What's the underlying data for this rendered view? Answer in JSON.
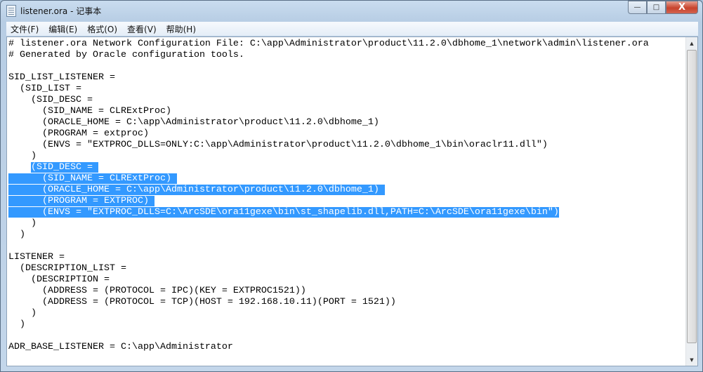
{
  "window": {
    "title": "listener.ora - 记事本",
    "minimize": "—",
    "maximize": "□",
    "close": "X"
  },
  "menu": [
    "文件(F)",
    "编辑(E)",
    "格式(O)",
    "查看(V)",
    "帮助(H)"
  ],
  "editor": {
    "lines": [
      {
        "text": "# listener.ora Network Configuration File: C:\\app\\Administrator\\product\\11.2.0\\dbhome_1\\network\\admin\\listener.ora"
      },
      {
        "text": "# Generated by Oracle configuration tools."
      },
      {
        "text": ""
      },
      {
        "text": "SID_LIST_LISTENER ="
      },
      {
        "text": "  (SID_LIST ="
      },
      {
        "text": "    (SID_DESC ="
      },
      {
        "text": "      (SID_NAME = CLRExtProc)"
      },
      {
        "text": "      (ORACLE_HOME = C:\\app\\Administrator\\product\\11.2.0\\dbhome_1)"
      },
      {
        "text": "      (PROGRAM = extproc)"
      },
      {
        "text": "      (ENVS = \"EXTPROC_DLLS=ONLY:C:\\app\\Administrator\\product\\11.2.0\\dbhome_1\\bin\\oraclr11.dll\")"
      },
      {
        "text": "    )"
      },
      {
        "text": "    ",
        "selected": "(SID_DESC = "
      },
      {
        "text": "",
        "selected": "      (SID_NAME = CLRExtProc) "
      },
      {
        "text": "",
        "selected": "      (ORACLE_HOME = C:\\app\\Administrator\\product\\11.2.0\\dbhome_1) "
      },
      {
        "text": "",
        "selected": "      (PROGRAM = EXTPROC) "
      },
      {
        "text": "",
        "selected": "      (ENVS = \"EXTPROC_DLLS=C:\\ArcSDE\\ora11gexe\\bin\\st_shapelib.dll,PATH=C:\\ArcSDE\\ora11gexe\\bin\")"
      },
      {
        "text": "    )"
      },
      {
        "text": "  )"
      },
      {
        "text": ""
      },
      {
        "text": "LISTENER ="
      },
      {
        "text": "  (DESCRIPTION_LIST ="
      },
      {
        "text": "    (DESCRIPTION ="
      },
      {
        "text": "      (ADDRESS = (PROTOCOL = IPC)(KEY = EXTPROC1521))"
      },
      {
        "text": "      (ADDRESS = (PROTOCOL = TCP)(HOST = 192.168.10.11)(PORT = 1521))"
      },
      {
        "text": "    )"
      },
      {
        "text": "  )"
      },
      {
        "text": ""
      },
      {
        "text": "ADR_BASE_LISTENER = C:\\app\\Administrator"
      }
    ]
  },
  "colors": {
    "selection": "#3399ff"
  }
}
